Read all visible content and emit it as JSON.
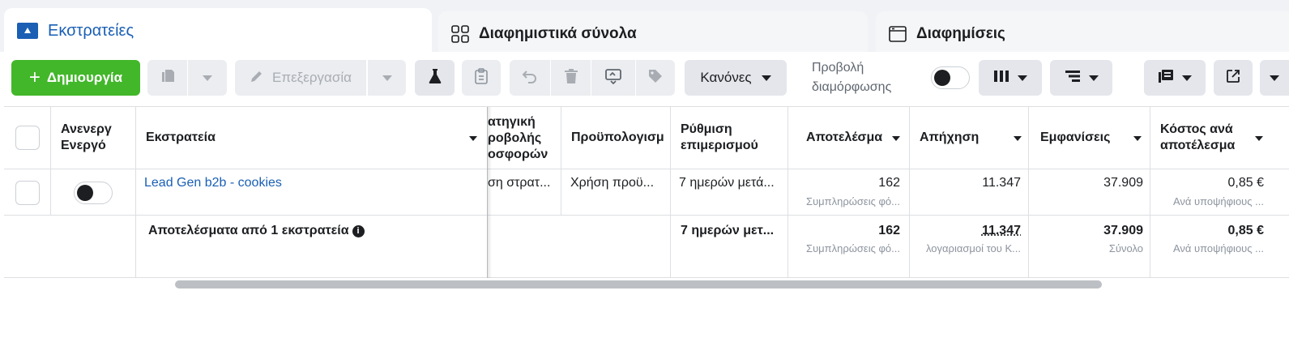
{
  "tabs": {
    "campaigns": "Εκστρατείες",
    "adsets": "Διαφημιστικά σύνολα",
    "ads": "Διαφημίσεις"
  },
  "toolbar": {
    "create": "Δημιουργία",
    "edit": "Επεξεργασία",
    "rules": "Κανόνες",
    "view_label_1": "Προβολή",
    "view_label_2": "διαμόρφωσης"
  },
  "columns": {
    "active": "Ανενεργ\nΕνεργό",
    "active_1": "Ανενεργ",
    "active_2": "Ενεργό",
    "campaign": "Εκστρατεία",
    "bid_1": "ατηγική",
    "bid_2": "ροβολής",
    "bid_3": "οσφορών",
    "budget": "Προϋπολογισμ",
    "attr_1": "Ρύθμιση",
    "attr_2": "επιμερισμού",
    "results": "Αποτελέσμα",
    "reach": "Απήχηση",
    "impressions": "Εμφανίσεις",
    "cpr_1": "Κόστος ανά",
    "cpr_2": "αποτέλεσμα"
  },
  "row": {
    "name": "Lead Gen b2b - cookies",
    "bid": "ση στρατ...",
    "budget": "Χρήση προϋ...",
    "attribution": "7 ημερών μετά...",
    "results": "162",
    "results_sub": "Συμπληρώσεις φό...",
    "reach": "11.347",
    "impressions": "37.909",
    "cpr": "0,85 €",
    "cpr_sub": "Ανά υποψήφιους ..."
  },
  "summary": {
    "label": "Αποτελέσματα από 1 εκστρατεία",
    "attribution": "7 ημερών μετ...",
    "results": "162",
    "results_sub": "Συμπληρώσεις φό...",
    "reach": "11.347",
    "reach_sub": "λογαριασμοί του Κ...",
    "impressions": "37.909",
    "impressions_sub": "Σύνολο",
    "cpr": "0,85 €",
    "cpr_sub": "Ανά υποψήφιους ..."
  },
  "colors": {
    "accent": "#1a5fb4",
    "create": "#42b72a"
  }
}
